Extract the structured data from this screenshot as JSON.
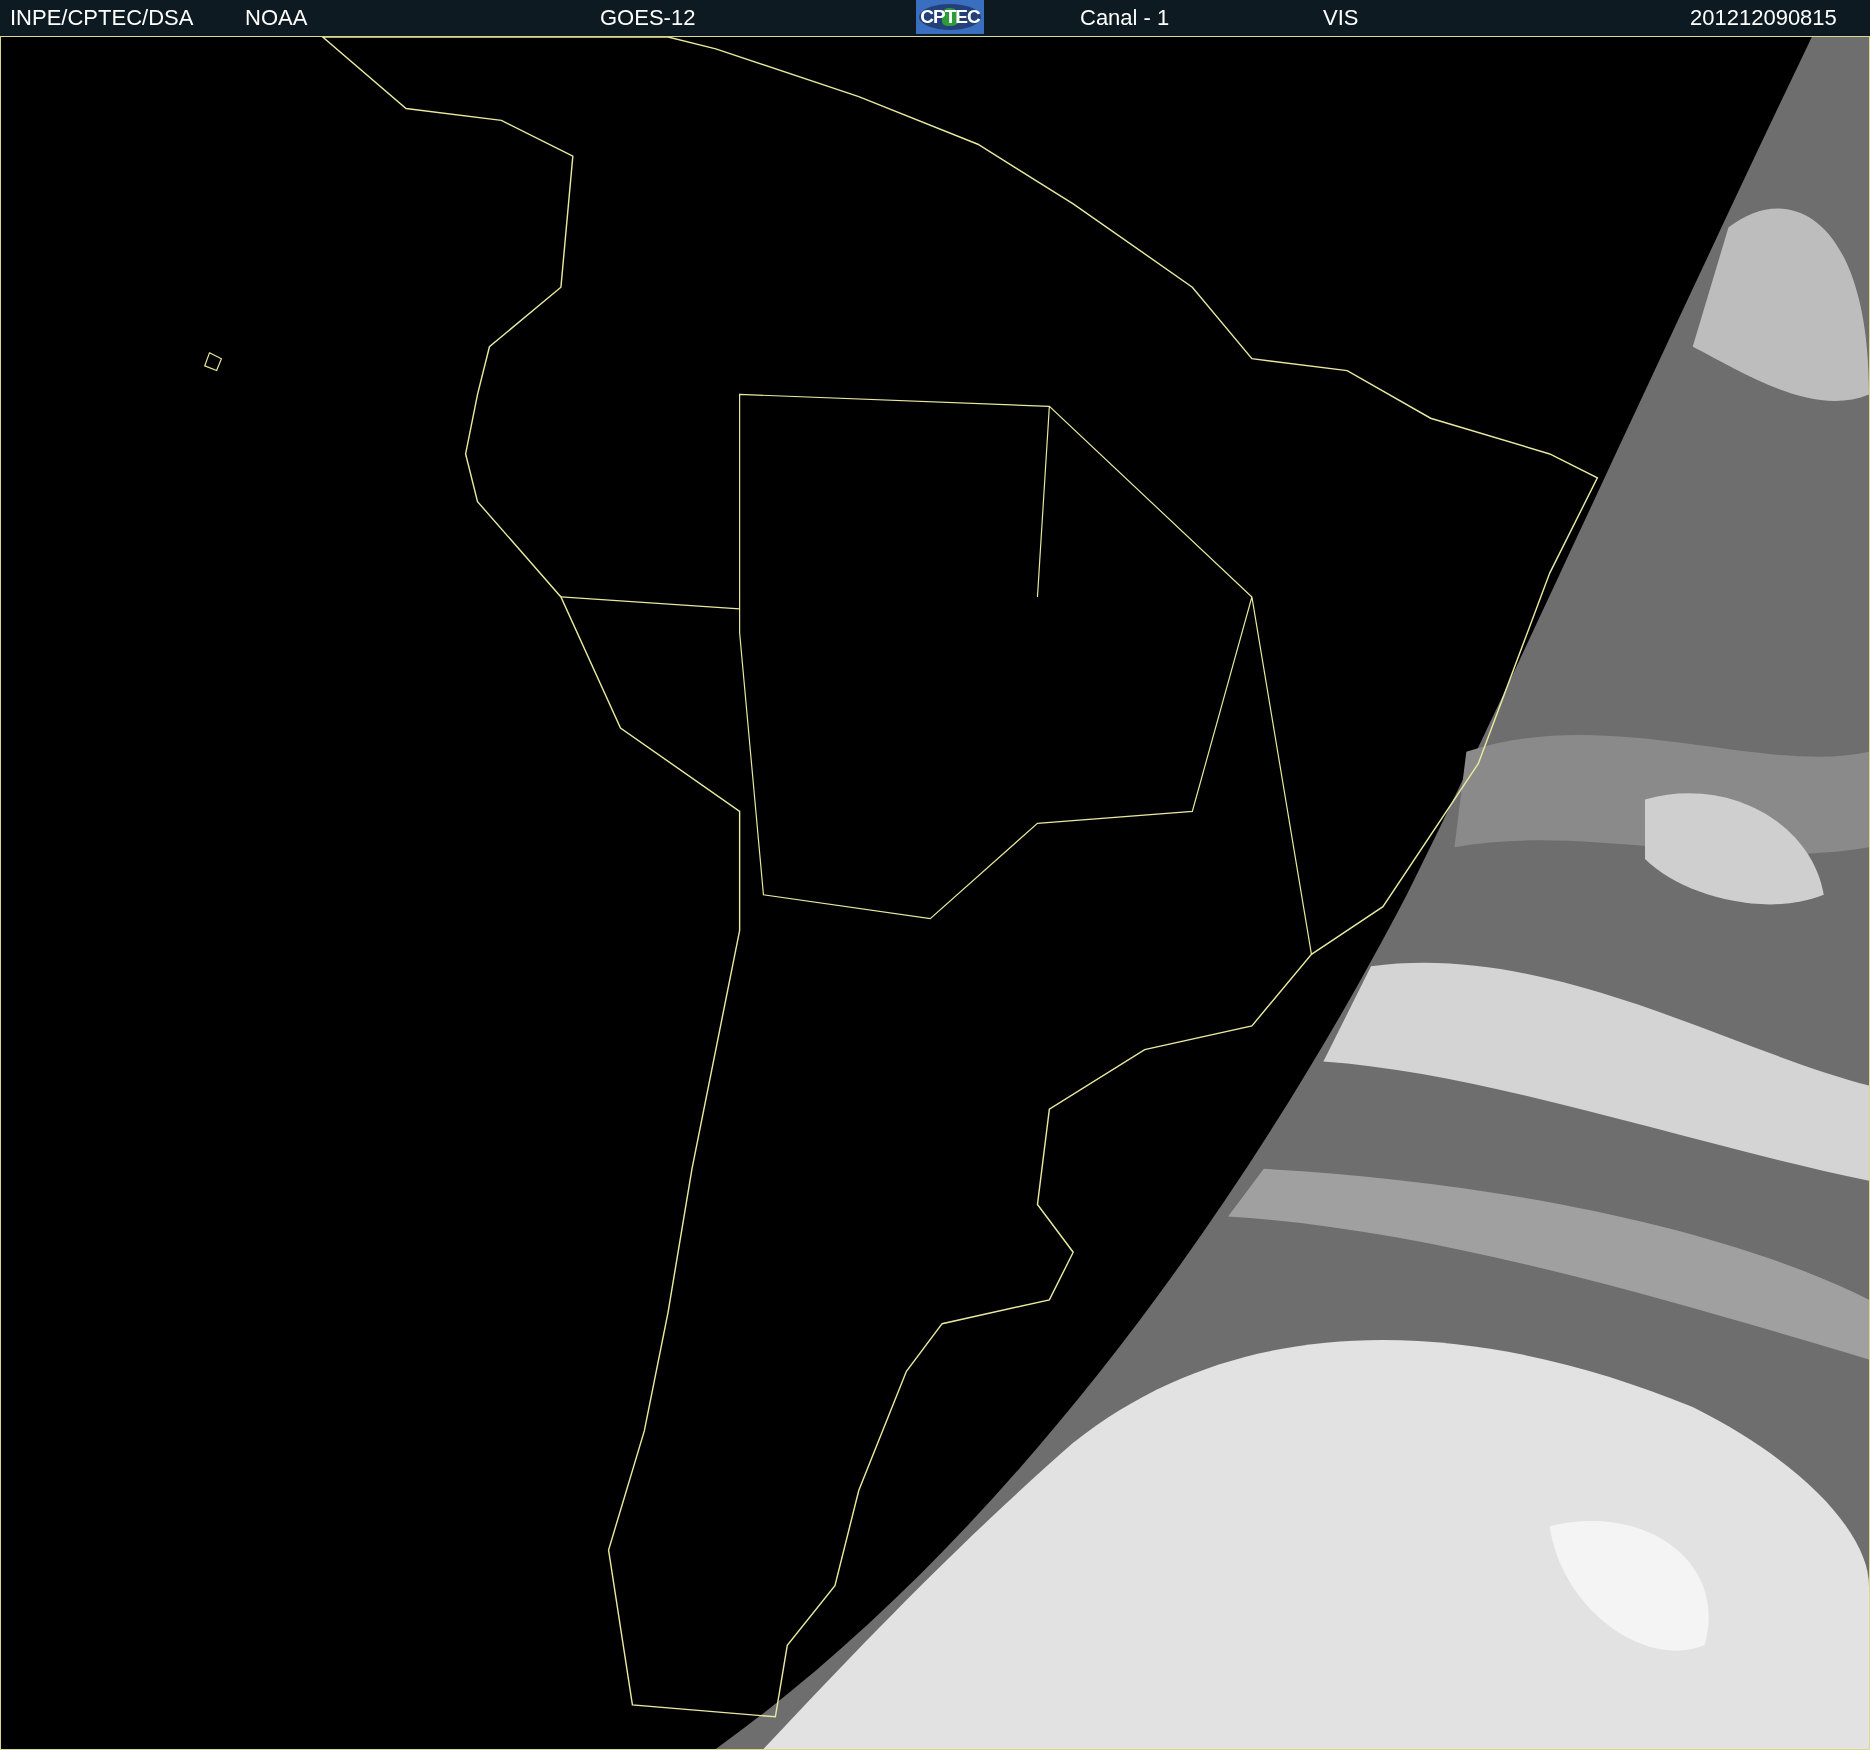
{
  "header": [
    {
      "kind": "text",
      "text": "INPE/CPTEC/DSA"
    },
    {
      "kind": "text",
      "text": "NOAA"
    },
    {
      "kind": "text",
      "text": "GOES-12"
    },
    {
      "kind": "logo",
      "text": "CPTEC"
    },
    {
      "kind": "text",
      "text": "Canal - 1"
    },
    {
      "kind": "text",
      "text": "VIS"
    },
    {
      "kind": "text",
      "text": "201212090815"
    }
  ]
}
